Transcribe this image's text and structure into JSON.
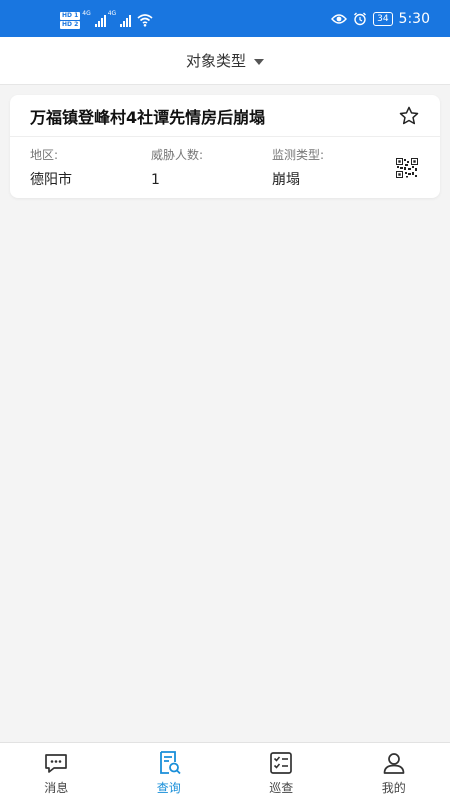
{
  "status_bar": {
    "sim1": "HD 1",
    "sim2": "HD 2",
    "network1": "4G",
    "network2": "4G",
    "battery": "34",
    "time": "5:30"
  },
  "header": {
    "title": "对象类型"
  },
  "items": [
    {
      "title": "万福镇登峰村4社谭先情房后崩塌",
      "region_label": "地区:",
      "region_value": "德阳市",
      "threat_label": "威胁人数:",
      "threat_value": "1",
      "monitor_label": "监测类型:",
      "monitor_value": "崩塌"
    }
  ],
  "tabs": [
    {
      "label": "消息",
      "icon": "message-icon",
      "active": false
    },
    {
      "label": "查询",
      "icon": "search-document-icon",
      "active": true
    },
    {
      "label": "巡查",
      "icon": "checklist-icon",
      "active": false
    },
    {
      "label": "我的",
      "icon": "user-icon",
      "active": false
    }
  ],
  "colors": {
    "brand": "#1976e0",
    "tab_active": "#1a8fd9",
    "background": "#f4f4f4"
  }
}
